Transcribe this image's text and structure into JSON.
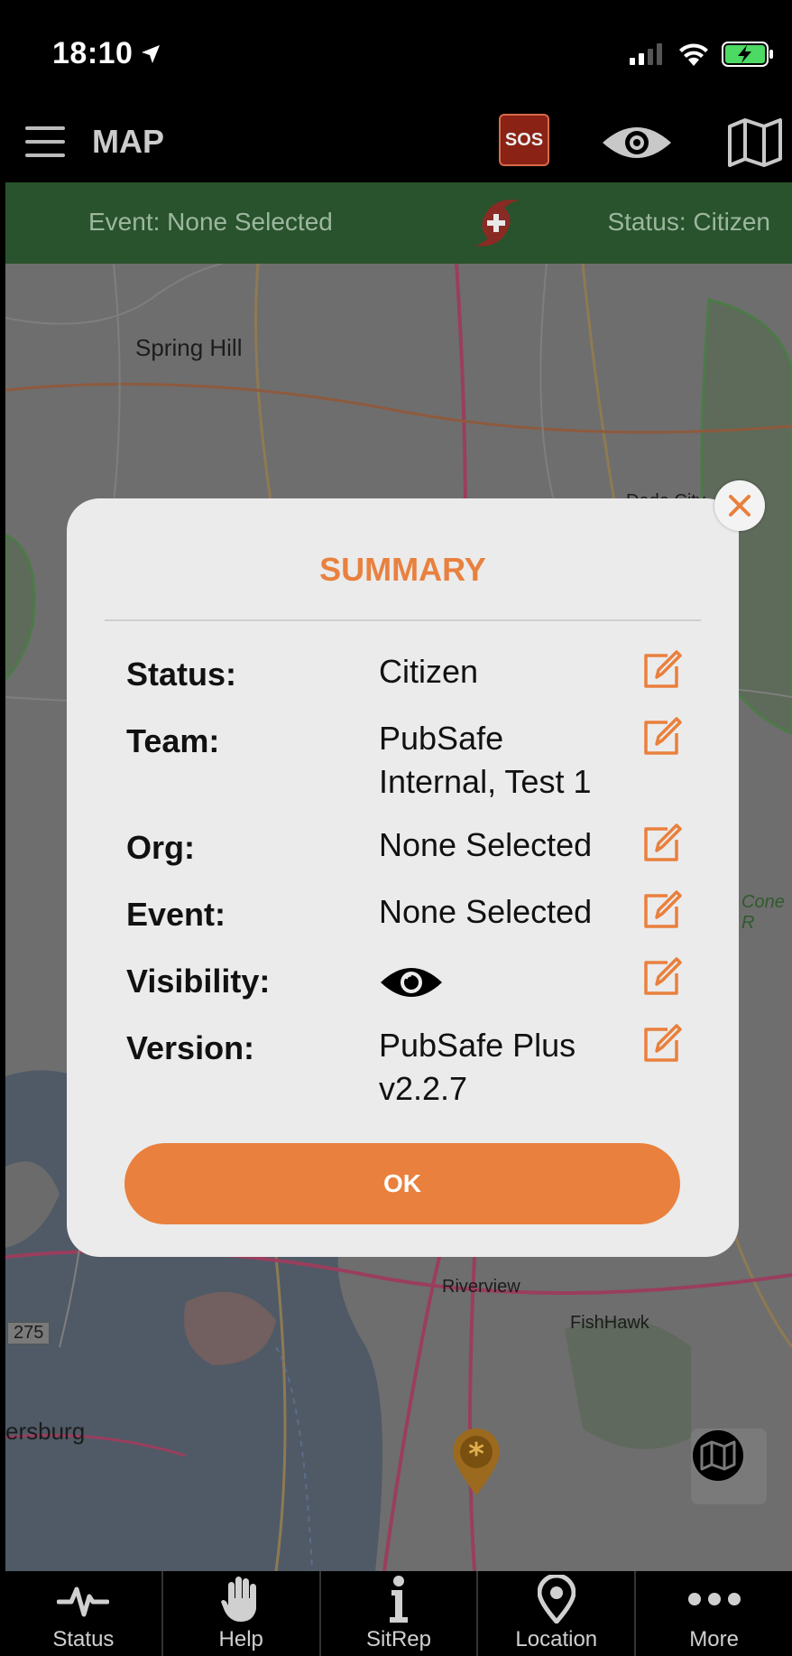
{
  "status_bar": {
    "time": "18:10"
  },
  "header": {
    "title": "MAP",
    "sos_label": "SOS"
  },
  "event_bar": {
    "event_text": "Event: None Selected",
    "status_text": "Status: Citizen"
  },
  "map": {
    "labels": {
      "spring_hill": "Spring Hill",
      "dade_city": "Dade City",
      "cone": "Cone R",
      "riverview": "Riverview",
      "fishhawk": "FishHawk",
      "route_275": "275",
      "petersburg": "ersburg"
    }
  },
  "summary": {
    "title": "SUMMARY",
    "rows": [
      {
        "label": "Status:",
        "value": "Citizen"
      },
      {
        "label": "Team:",
        "value": "PubSafe Internal, Test 1"
      },
      {
        "label": "Org:",
        "value": "None Selected"
      },
      {
        "label": "Event:",
        "value": "None Selected"
      },
      {
        "label": "Visibility:",
        "value_icon": "eye-icon"
      },
      {
        "label": "Version:",
        "value": "PubSafe Plus v2.2.7"
      }
    ],
    "ok_label": "OK"
  },
  "tabs": [
    {
      "label": "Status",
      "icon": "heartbeat-icon"
    },
    {
      "label": "Help",
      "icon": "hand-icon"
    },
    {
      "label": "SitRep",
      "icon": "info-icon"
    },
    {
      "label": "Location",
      "icon": "location-pin-icon"
    },
    {
      "label": "More",
      "icon": "more-dots-icon"
    }
  ],
  "colors": {
    "accent": "#e9803d",
    "event_bar": "#28532c",
    "sos": "#8a2215",
    "dialog_bg": "#ebebeb"
  }
}
